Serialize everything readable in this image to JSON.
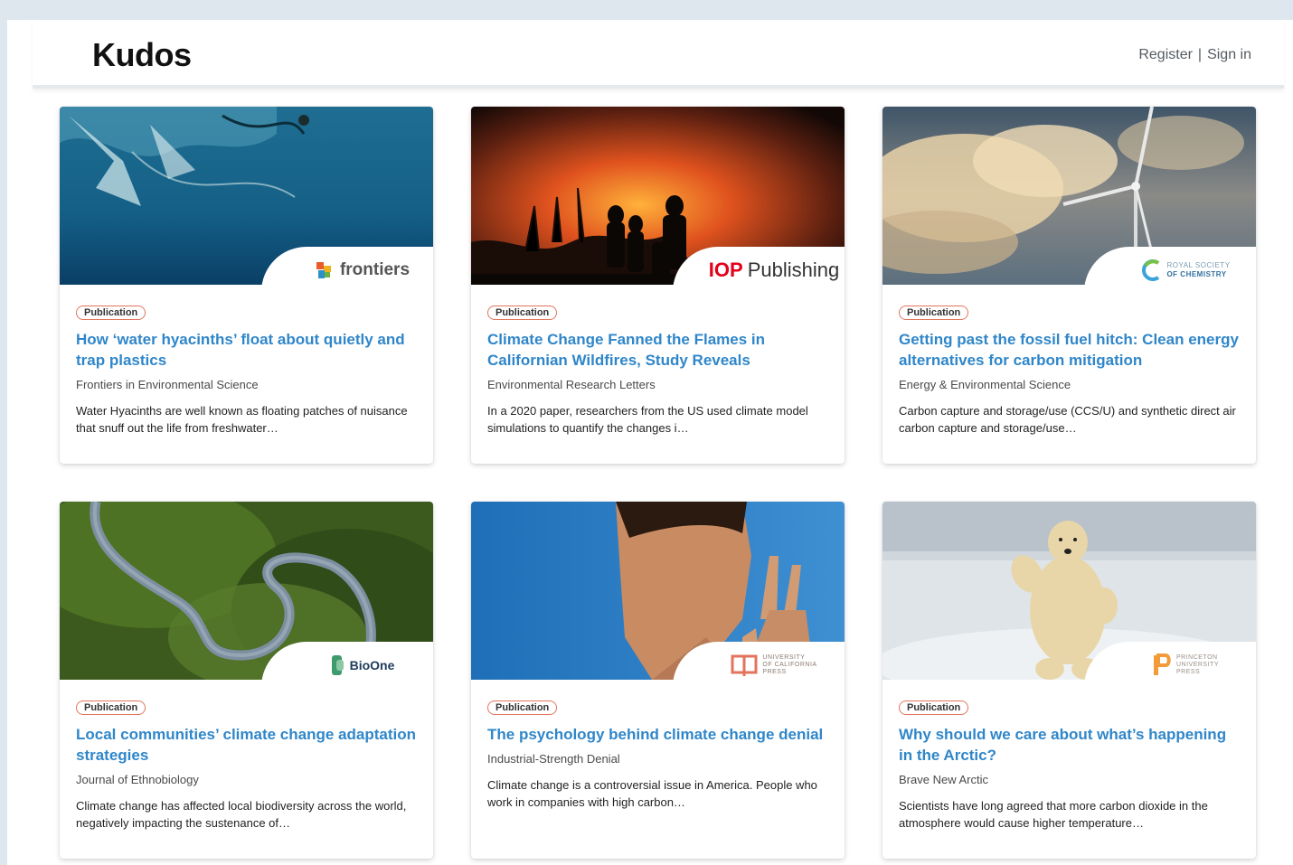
{
  "header": {
    "brand": "Kudos",
    "register_label": "Register",
    "separator": "|",
    "signin_label": "Sign in"
  },
  "cards": [
    {
      "badge": "Publication",
      "title": "How ‘water hyacinths’ float about quietly and trap plastics",
      "journal": "Frontiers in Environmental Science",
      "summary": "Water Hyacinths are well known as floating patches of nuisance that snuff out the life from freshwater…",
      "publisher": "frontiers",
      "image_icon": "underwater-plastics-image"
    },
    {
      "badge": "Publication",
      "title": "Climate Change Fanned the Flames in Californian Wildfires, Study Reveals",
      "journal": "Environmental Research Letters",
      "summary": "In a 2020 paper, researchers from the US used climate model simulations to quantify the changes i…",
      "publisher_strong": "IOP",
      "publisher": "Publishing",
      "image_icon": "wildfire-image"
    },
    {
      "badge": "Publication",
      "title": "Getting past the fossil fuel hitch: Clean energy alternatives for carbon mitigation",
      "journal": "Energy & Environmental Science",
      "summary": "Carbon capture and storage/use (CCS/U) and synthetic direct air carbon capture and storage/use…",
      "publisher_line1": "ROYAL SOCIETY",
      "publisher_line2": "OF CHEMISTRY",
      "image_icon": "wind-turbine-image"
    },
    {
      "badge": "Publication",
      "title": "Local communities’ climate change adaptation strategies",
      "journal": "Journal of Ethnobiology",
      "summary": "Climate change has affected local biodiversity across the world, negatively impacting the sustenance of…",
      "publisher": "BioOne",
      "image_icon": "river-forest-image"
    },
    {
      "badge": "Publication",
      "title": "The psychology behind climate change denial",
      "journal": "Industrial-Strength Denial",
      "summary": "Climate change is a controversial issue in America. People who work in companies with high carbon…",
      "publisher_line1": "UNIVERSITY",
      "publisher_line2": "OF CALIFORNIA",
      "publisher_line3": "PRESS",
      "image_icon": "man-waving-image"
    },
    {
      "badge": "Publication",
      "title": "Why should we care about what’s happening in the Arctic?",
      "journal": "Brave New Arctic",
      "summary": "Scientists have long agreed that more carbon dioxide in the atmosphere would cause higher temperature…",
      "publisher_line1": "PRINCETON",
      "publisher_line2": "UNIVERSITY",
      "publisher_line3": "PRESS",
      "image_icon": "polar-bear-image"
    }
  ],
  "colors": {
    "link": "#2f86c9",
    "badge_border": "#e2745c",
    "iop_red": "#e3001b"
  }
}
